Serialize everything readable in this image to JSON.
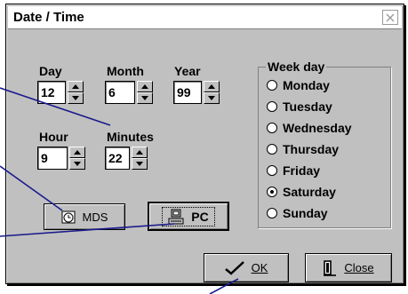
{
  "dialog": {
    "title": "Date / Time",
    "close_icon": "close-icon"
  },
  "date": {
    "day": {
      "label": "Day",
      "value": "12"
    },
    "month": {
      "label": "Month",
      "value": "6"
    },
    "year": {
      "label": "Year",
      "value": "99"
    }
  },
  "time": {
    "hour": {
      "label": "Hour",
      "value": "9"
    },
    "minutes": {
      "label": "Minutes",
      "value": "22"
    }
  },
  "weekday": {
    "legend": "Week day",
    "options": [
      "Monday",
      "Tuesday",
      "Wednesday",
      "Thursday",
      "Friday",
      "Saturday",
      "Sunday"
    ],
    "selected": "Saturday"
  },
  "buttons": {
    "mds": {
      "label": "MDS",
      "icon": "clock-icon"
    },
    "pc": {
      "label": "PC",
      "icon": "computer-icon"
    },
    "ok": {
      "label": "OK",
      "icon": "checkmark-icon"
    },
    "close": {
      "label": "Close",
      "icon": "door-exit-icon"
    }
  },
  "colors": {
    "dialog_bg": "#c0c0c0",
    "callout_line": "#1a1a8c"
  }
}
